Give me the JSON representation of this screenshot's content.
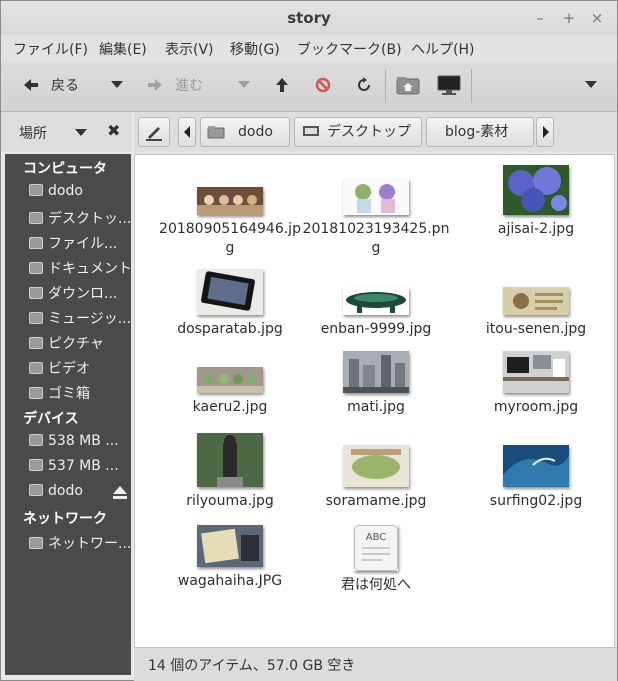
{
  "window": {
    "title": "story"
  },
  "menubar": [
    "ファイル(F)",
    "編集(E)",
    "表示(V)",
    "移動(G)",
    "ブックマーク(B)",
    "ヘルプ(H)"
  ],
  "toolbar": {
    "back_label": "戻る",
    "forward_label": "進む"
  },
  "places": {
    "label": "場所"
  },
  "pathbar": [
    "dodo",
    "デスクトップ",
    "blog-素材"
  ],
  "sidebar": {
    "computer_header": "コンピュータ",
    "computer_items": [
      "dodo",
      "デスクトッ...",
      "ファイル...",
      "ドキュメント",
      "ダウンロ...",
      "ミュージッ...",
      "ピクチャ",
      "ビデオ",
      "ゴミ箱"
    ],
    "devices_header": "デバイス",
    "device_items": [
      "538 MB ...",
      "537 MB ...",
      "dodo"
    ],
    "network_header": "ネットワーク",
    "network_items": [
      "ネットワー..."
    ]
  },
  "files": [
    "20180905164946.jpg",
    "20181023193425.png",
    "ajisai-2.jpg",
    "dosparatab.jpg",
    "enban-9999.jpg",
    "itou-senen.jpg",
    "kaeru2.jpg",
    "mati.jpg",
    "myroom.jpg",
    "rilyouma.jpg",
    "soramame.jpg",
    "surfing02.jpg",
    "wagahaiha.JPG",
    "君は何処へ"
  ],
  "text_file_preview": "ABC",
  "status": {
    "text": "14 個のアイテム、57.0 GB 空き"
  },
  "colors": {
    "sidebar_bg": "#4b4b4b",
    "content_bg": "#ffffff",
    "toolbar_bg": "#d6d6d6",
    "stop_red": "#d9534f"
  }
}
